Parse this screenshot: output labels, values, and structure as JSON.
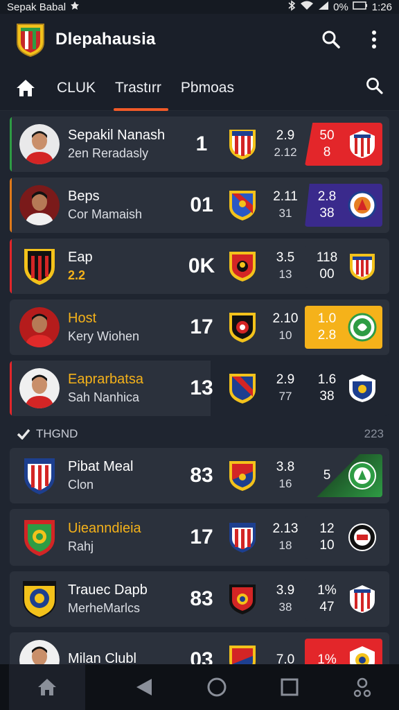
{
  "status": {
    "carrier": "Sepak Babal",
    "battery": "0%",
    "time": "1:26"
  },
  "app": {
    "title": "Dlepahausia"
  },
  "tabs": [
    {
      "label": "CLUK"
    },
    {
      "label": "Trastırr"
    },
    {
      "label": "Pbmoas"
    }
  ],
  "rows": [
    {
      "name": "Sepakil Nanash",
      "sub": "2en Reradasly",
      "score": "1",
      "stat_top": "2.9",
      "stat_bot": "2.12",
      "box_top": "50",
      "box_bot": "8",
      "box_color": "#e3262a",
      "accent": "#2e9c44"
    },
    {
      "name": "Beps",
      "sub": "Cor Mamaish",
      "score": "01",
      "stat_top": "2.11",
      "stat_bot": "31",
      "box_top": "2.8",
      "box_bot": "38",
      "box_color": "#3a2a8c",
      "accent": "#e07a1a"
    },
    {
      "name": "Eap",
      "sub": "2.2",
      "score": "0K",
      "stat_top": "3.5",
      "stat_bot": "13",
      "box_top": "118",
      "box_bot": "00",
      "box_color": "#2b313c",
      "accent": "#e3262a"
    },
    {
      "name": "Host",
      "sub": "Kery Wiohen",
      "score": "17",
      "stat_top": "2.10",
      "stat_bot": "10",
      "box_top": "1.0",
      "box_bot": "2.8",
      "box_color": "#f5b21a",
      "accent": "#2b313c"
    },
    {
      "name": "Eaprarbatsa",
      "sub": "Sah Nanhica",
      "score": "13",
      "stat_top": "2.9",
      "stat_bot": "77",
      "box_top": "1.6",
      "box_bot": "38",
      "box_color": "#1f2530",
      "accent": "#e3262a"
    }
  ],
  "section": {
    "label": "THGND",
    "count": "223"
  },
  "rows2": [
    {
      "name": "Pibat Meal",
      "sub": "Clon",
      "score": "83",
      "stat_top": "3.8",
      "stat_bot": "16",
      "box_top": "5",
      "box_bot": "",
      "box_color": "#2b313c",
      "accent": "#2b313c"
    },
    {
      "name": "Uieanndieia",
      "sub": "Rahj",
      "score": "17",
      "stat_top": "2.13",
      "stat_bot": "18",
      "box_top": "12",
      "box_bot": "10",
      "box_color": "#2b313c",
      "accent": "#2b313c"
    },
    {
      "name": "Trauec Dapb",
      "sub": "MerheMarlcs",
      "score": "83",
      "stat_top": "3.9",
      "stat_bot": "38",
      "box_top": "1%",
      "box_bot": "47",
      "box_color": "#2b313c",
      "accent": "#2b313c"
    },
    {
      "name": "Milan Clubl",
      "sub": "",
      "score": "03",
      "stat_top": "7.0",
      "stat_bot": "",
      "box_top": "1%",
      "box_bot": "",
      "box_color": "#e3262a",
      "accent": "#2b313c"
    }
  ],
  "colors": {
    "accent": "#f05a28",
    "background": "#1f2530",
    "card": "#2b313c"
  }
}
